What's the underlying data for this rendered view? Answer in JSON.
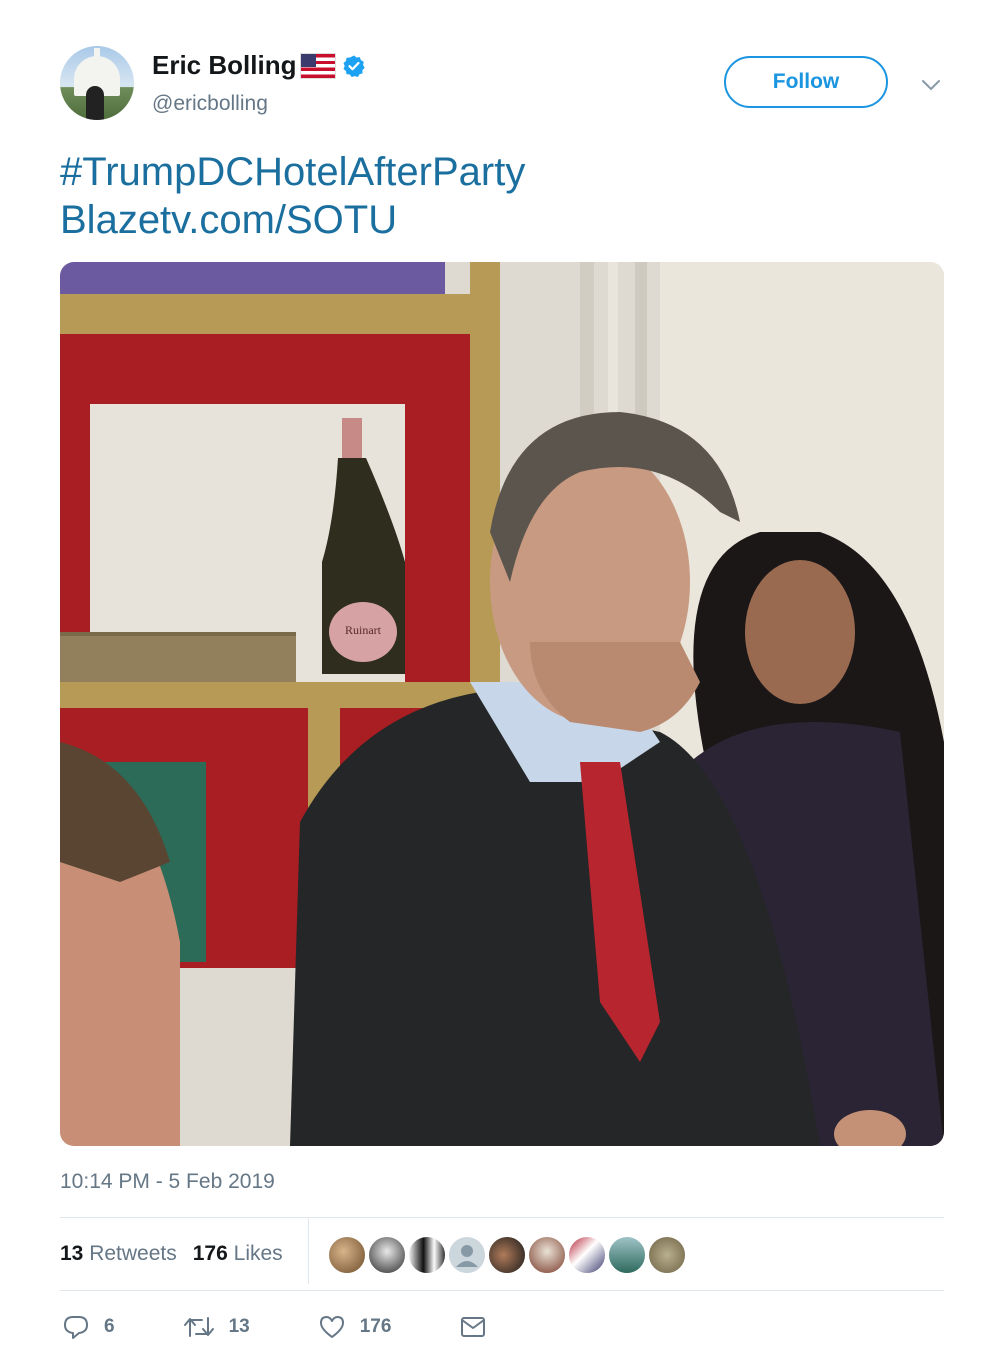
{
  "author": {
    "name": "Eric Bolling",
    "handle": "@ericbolling"
  },
  "follow_label": "Follow",
  "tweet": {
    "line1": "#TrumpDCHotelAfterParty",
    "line2": "Blazetv.com/SOTU"
  },
  "photo": {
    "bottle_label": "Ruinart"
  },
  "timestamp": "10:14 PM - 5 Feb 2019",
  "stats": {
    "retweets_count": "13",
    "retweets_label": "Retweets",
    "likes_count": "176",
    "likes_label": "Likes"
  },
  "actions": {
    "replies": "6",
    "retweets": "13",
    "likes": "176"
  },
  "colors": {
    "link": "#1b6f9f",
    "accent": "#1b95e0",
    "muted": "#657786"
  },
  "icons": [
    "verified-badge-icon",
    "us-flag-icon",
    "chevron-down-icon",
    "reply-icon",
    "retweet-icon",
    "like-icon",
    "message-icon"
  ]
}
